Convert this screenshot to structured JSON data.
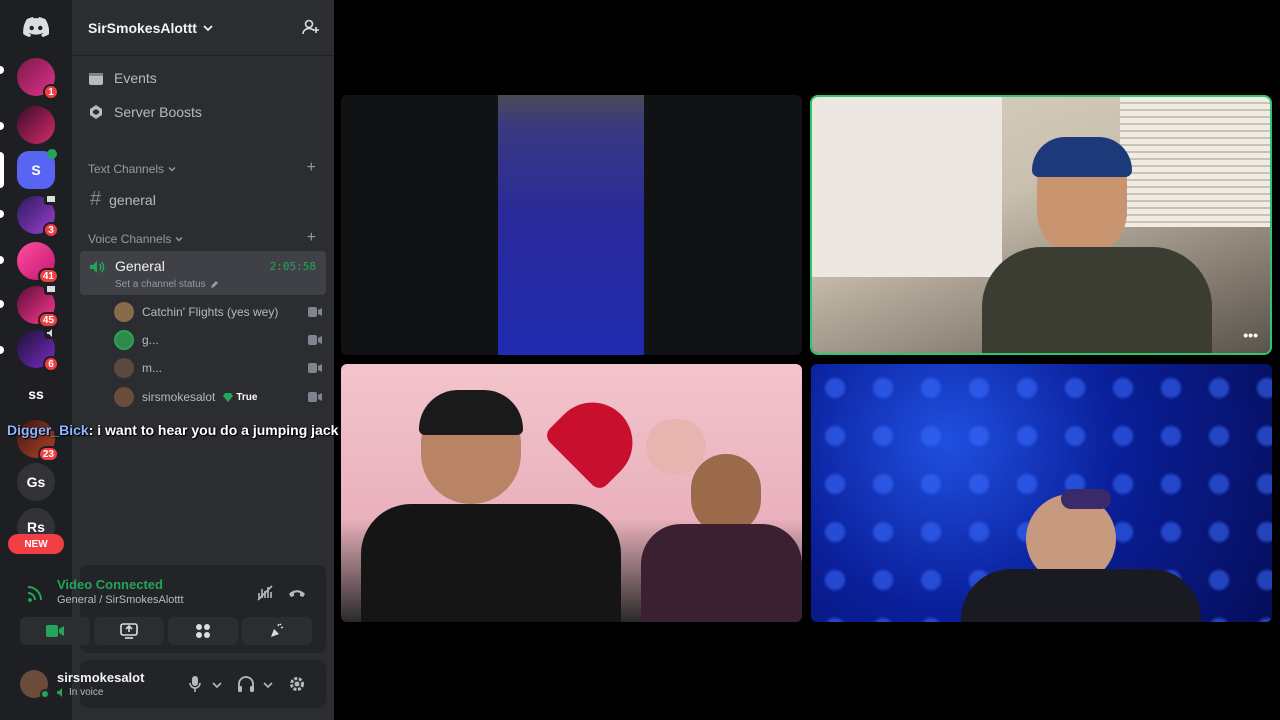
{
  "server": {
    "name": "SirSmokesAlottt"
  },
  "rail": {
    "badges": [
      "1",
      "3",
      "41",
      "45",
      "6",
      "23"
    ],
    "text_servers": [
      "ss",
      "Gs",
      "Rs"
    ],
    "selected_letter": "S",
    "new_label": "NEW"
  },
  "sidebar": {
    "events": "Events",
    "boosts": "Server Boosts",
    "text_category": "Text Channels",
    "text_channel": "general",
    "voice_category": "Voice Channels",
    "voice_channel": "General",
    "timer": "2:05:58",
    "status_prompt": "Set a channel status",
    "members": [
      {
        "name": "Catchin' Flights (yes wey)"
      },
      {
        "name": "g..."
      },
      {
        "name": "m..."
      },
      {
        "name": "sirsmokesalot",
        "tag": "True"
      }
    ]
  },
  "chat_overlay": {
    "user": "Digger_Bick",
    "message": ": i want to hear you do a jumping jack"
  },
  "voice_panel": {
    "title": "Video Connected",
    "subtitle": "General / SirSmokesAlottt"
  },
  "user_panel": {
    "name": "sirsmokesalot",
    "status": "In voice"
  },
  "colors": {
    "accent_green": "#23a55a",
    "speaking_outline": "#2dc770",
    "badge_red": "#f23f43",
    "brand": "#5865f2"
  }
}
